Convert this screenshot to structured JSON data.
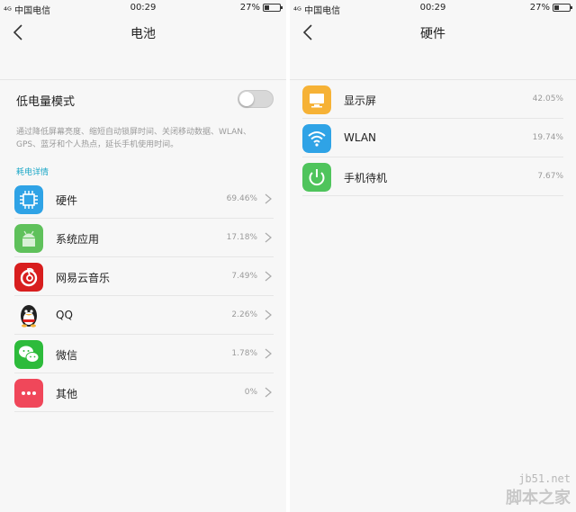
{
  "left": {
    "status": {
      "carrier": "中国电信",
      "time": "00:29",
      "battery": "27%"
    },
    "title": "电池",
    "low_power": {
      "label": "低电量模式",
      "enabled": false
    },
    "description": "通过降低屏幕亮度、缩短自动锁屏时间、关闭移动数据、WLAN、GPS、蓝牙和个人热点，延长手机使用时间。",
    "section_label": "耗电详情",
    "items": [
      {
        "name": "硬件",
        "pct": "69.46%",
        "icon": "chip-icon",
        "color": "#2fa3e6"
      },
      {
        "name": "系统应用",
        "pct": "17.18%",
        "icon": "android-icon",
        "color": "#5fc15b"
      },
      {
        "name": "网易云音乐",
        "pct": "7.49%",
        "icon": "netease-music-icon",
        "color": "#d81e1e"
      },
      {
        "name": "QQ",
        "pct": "2.26%",
        "icon": "qq-penguin-icon",
        "color": "#222222"
      },
      {
        "name": "微信",
        "pct": "1.78%",
        "icon": "wechat-icon",
        "color": "#2dbb3b"
      },
      {
        "name": "其他",
        "pct": "0%",
        "icon": "more-dots-icon",
        "color": "#f0475a"
      }
    ]
  },
  "right": {
    "status": {
      "carrier": "中国电信",
      "time": "00:29",
      "battery": "27%"
    },
    "title": "硬件",
    "items": [
      {
        "name": "显示屏",
        "pct": "42.05%",
        "icon": "monitor-icon",
        "color": "#f6b236"
      },
      {
        "name": "WLAN",
        "pct": "19.74%",
        "icon": "wifi-icon",
        "color": "#2fa3e6"
      },
      {
        "name": "手机待机",
        "pct": "7.67%",
        "icon": "power-icon",
        "color": "#4fc45c"
      }
    ]
  },
  "watermark": {
    "url": "jb51.net",
    "site": "脚本之家"
  }
}
